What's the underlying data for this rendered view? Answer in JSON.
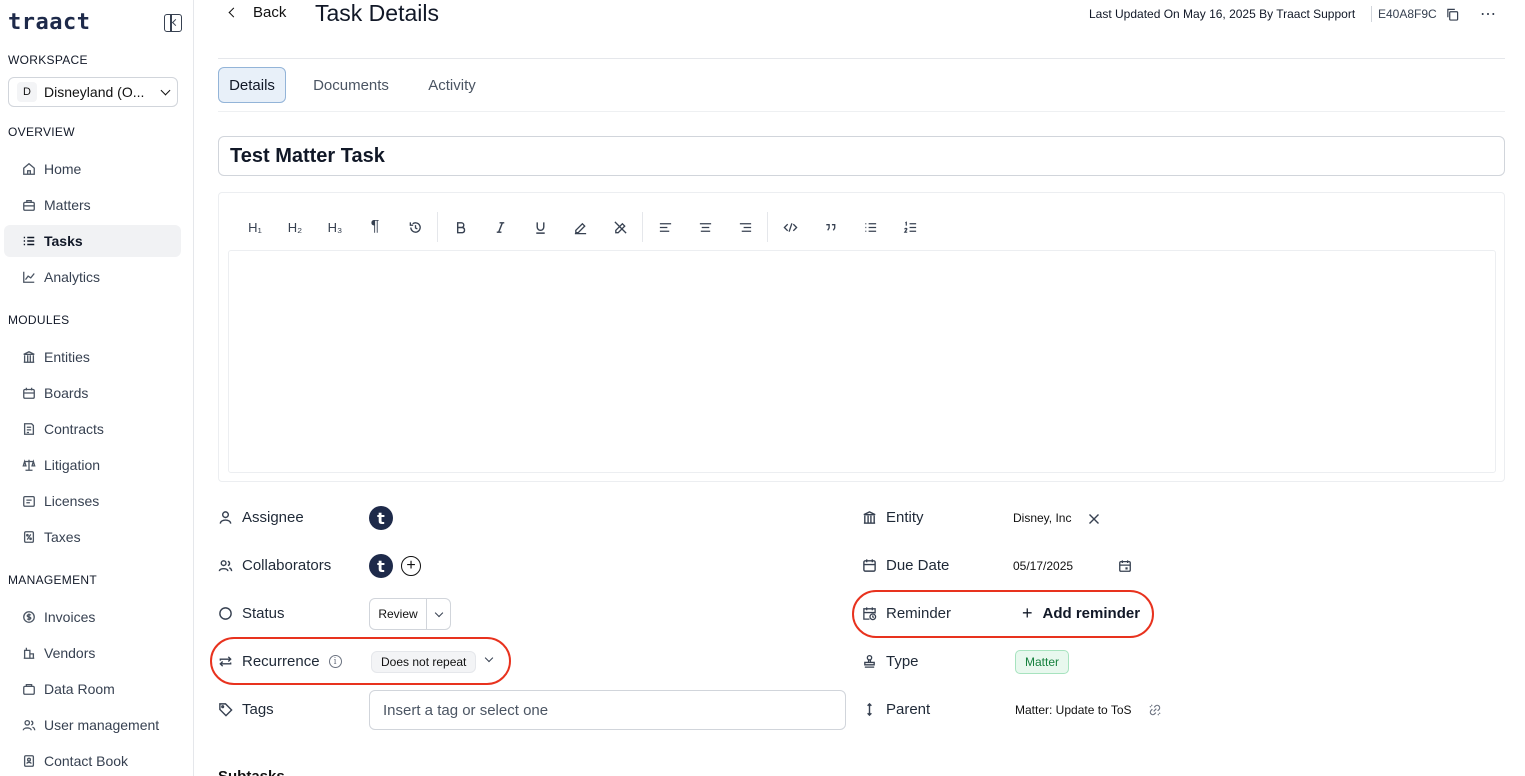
{
  "app": {
    "logo": "traact"
  },
  "sidebar": {
    "workspace_label": "WORKSPACE",
    "workspace": {
      "badge": "D",
      "name": "Disneyland (O..."
    },
    "overview_label": "OVERVIEW",
    "overview_items": [
      {
        "label": "Home",
        "icon": "home-icon"
      },
      {
        "label": "Matters",
        "icon": "briefcase-icon"
      },
      {
        "label": "Tasks",
        "icon": "task-list-icon",
        "active": true
      },
      {
        "label": "Analytics",
        "icon": "chart-icon"
      }
    ],
    "modules_label": "MODULES",
    "modules_items": [
      {
        "label": "Entities",
        "icon": "building-icon"
      },
      {
        "label": "Boards",
        "icon": "boards-icon"
      },
      {
        "label": "Contracts",
        "icon": "contract-icon"
      },
      {
        "label": "Litigation",
        "icon": "scale-icon"
      },
      {
        "label": "Licenses",
        "icon": "license-icon"
      },
      {
        "label": "Taxes",
        "icon": "tax-icon"
      }
    ],
    "management_label": "MANAGEMENT",
    "management_items": [
      {
        "label": "Invoices",
        "icon": "dollar-icon"
      },
      {
        "label": "Vendors",
        "icon": "vendor-icon"
      },
      {
        "label": "Data Room",
        "icon": "folder-icon"
      },
      {
        "label": "User management",
        "icon": "users-icon"
      },
      {
        "label": "Contact Book",
        "icon": "contact-book-icon"
      }
    ]
  },
  "header": {
    "back_label": "Back",
    "title": "Task Details",
    "last_updated": "Last Updated On May 16, 2025 By Traact Support",
    "record_id": "E40A8F9C",
    "more": "⋯"
  },
  "tabs": [
    {
      "label": "Details",
      "active": true
    },
    {
      "label": "Documents"
    },
    {
      "label": "Activity"
    }
  ],
  "task": {
    "name": "Test Matter Task"
  },
  "toolbar": {
    "h1": "H₁",
    "h2": "H₂",
    "h3": "H₃",
    "paragraph": "¶"
  },
  "fields_left": {
    "assignee_label": "Assignee",
    "assignee_avatar": "t",
    "collaborators_label": "Collaborators",
    "collaborator_avatar": "t",
    "add_symbol": "+",
    "status_label": "Status",
    "status_value": "Review",
    "recurrence_label": "Recurrence",
    "recurrence_info": "i",
    "recurrence_value": "Does not repeat",
    "tags_label": "Tags",
    "tags_placeholder": "Insert a tag or select one"
  },
  "fields_right": {
    "entity_label": "Entity",
    "entity_value": "Disney, Inc",
    "due_date_label": "Due Date",
    "due_date_value": "05/17/2025",
    "reminder_label": "Reminder",
    "add_reminder_label": "Add reminder",
    "add_reminder_symbol": "+",
    "type_label": "Type",
    "type_value": "Matter",
    "parent_label": "Parent",
    "parent_value": "Matter: Update to ToS"
  },
  "footer": {
    "partial_heading": "Subtasks"
  },
  "colors": {
    "accent_tab_bg": "#e8f0f9",
    "accent_tab_border": "#93b4d8",
    "highlight": "#e8321e",
    "type_badge": "#15803d",
    "brand": "#1e2a4a"
  }
}
